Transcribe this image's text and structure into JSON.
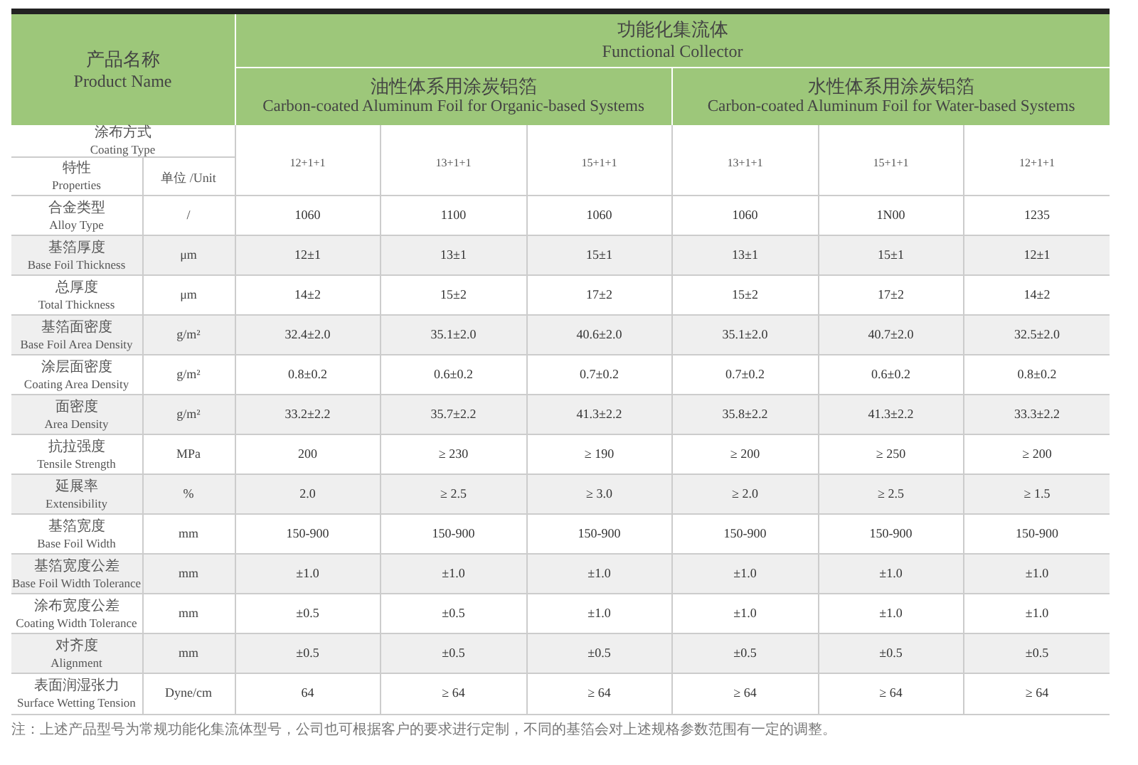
{
  "header": {
    "product_name": {
      "zh": "产品名称",
      "en": "Product Name"
    },
    "group": {
      "zh": "功能化集流体",
      "en": "Functional Collector"
    },
    "subgroups": [
      {
        "zh": "油性体系用涂炭铝箔",
        "en": "Carbon-coated Aluminum Foil for Organic-based Systems"
      },
      {
        "zh": "水性体系用涂炭铝箔",
        "en": "Carbon-coated Aluminum Foil for Water-based Systems"
      }
    ]
  },
  "coating_type": {
    "zh": "涂布方式",
    "en": "Coating Type",
    "values": [
      "12+1+1",
      "13+1+1",
      "15+1+1",
      "13+1+1",
      "15+1+1",
      "12+1+1"
    ]
  },
  "properties_label": {
    "zh": "特性",
    "en": "Properties"
  },
  "unit_label": "单位 /Unit",
  "rows": [
    {
      "zh": "合金类型",
      "en": "Alloy Type",
      "unit": "/",
      "values": [
        "1060",
        "1100",
        "1060",
        "1060",
        "1N00",
        "1235"
      ]
    },
    {
      "zh": "基箔厚度",
      "en": "Base Foil Thickness",
      "unit": "μm",
      "values": [
        "12±1",
        "13±1",
        "15±1",
        "13±1",
        "15±1",
        "12±1"
      ]
    },
    {
      "zh": "总厚度",
      "en": "Total Thickness",
      "unit": "μm",
      "values": [
        "14±2",
        "15±2",
        "17±2",
        "15±2",
        "17±2",
        "14±2"
      ]
    },
    {
      "zh": "基箔面密度",
      "en": "Base Foil Area Density",
      "unit": "g/m²",
      "values": [
        "32.4±2.0",
        "35.1±2.0",
        "40.6±2.0",
        "35.1±2.0",
        "40.7±2.0",
        "32.5±2.0"
      ]
    },
    {
      "zh": "涂层面密度",
      "en": "Coating Area Density",
      "unit": "g/m²",
      "values": [
        "0.8±0.2",
        "0.6±0.2",
        "0.7±0.2",
        "0.7±0.2",
        "0.6±0.2",
        "0.8±0.2"
      ]
    },
    {
      "zh": "面密度",
      "en": "Area Density",
      "unit": "g/m²",
      "values": [
        "33.2±2.2",
        "35.7±2.2",
        "41.3±2.2",
        "35.8±2.2",
        "41.3±2.2",
        "33.3±2.2"
      ]
    },
    {
      "zh": "抗拉强度",
      "en": "Tensile Strength",
      "unit": "MPa",
      "values": [
        "200",
        "≥ 230",
        "≥ 190",
        "≥ 200",
        "≥ 250",
        "≥ 200"
      ]
    },
    {
      "zh": "延展率",
      "en": "Extensibility",
      "unit": "%",
      "values": [
        "2.0",
        "≥ 2.5",
        "≥ 3.0",
        "≥ 2.0",
        "≥ 2.5",
        "≥ 1.5"
      ]
    },
    {
      "zh": "基箔宽度",
      "en": "Base Foil Width",
      "unit": "mm",
      "values": [
        "150-900",
        "150-900",
        "150-900",
        "150-900",
        "150-900",
        "150-900"
      ]
    },
    {
      "zh": "基箔宽度公差",
      "en": "Base Foil Width Tolerance",
      "unit": "mm",
      "values": [
        "±1.0",
        "±1.0",
        "±1.0",
        "±1.0",
        "±1.0",
        "±1.0"
      ]
    },
    {
      "zh": "涂布宽度公差",
      "en": "Coating Width Tolerance",
      "unit": "mm",
      "values": [
        "±0.5",
        "±0.5",
        "±1.0",
        "±1.0",
        "±1.0",
        "±1.0"
      ]
    },
    {
      "zh": "对齐度",
      "en": "Alignment",
      "unit": "mm",
      "values": [
        "±0.5",
        "±0.5",
        "±0.5",
        "±0.5",
        "±0.5",
        "±0.5"
      ]
    },
    {
      "zh": "表面润湿张力",
      "en": "Surface Wetting Tension",
      "unit": "Dyne/cm",
      "values": [
        "64",
        "≥ 64",
        "≥ 64",
        "≥ 64",
        "≥ 64",
        "≥ 64"
      ]
    }
  ],
  "footnote": "注：上述产品型号为常规功能化集流体型号，公司也可根据客户的要求进行定制，不同的基箔会对上述规格参数范围有一定的调整。"
}
